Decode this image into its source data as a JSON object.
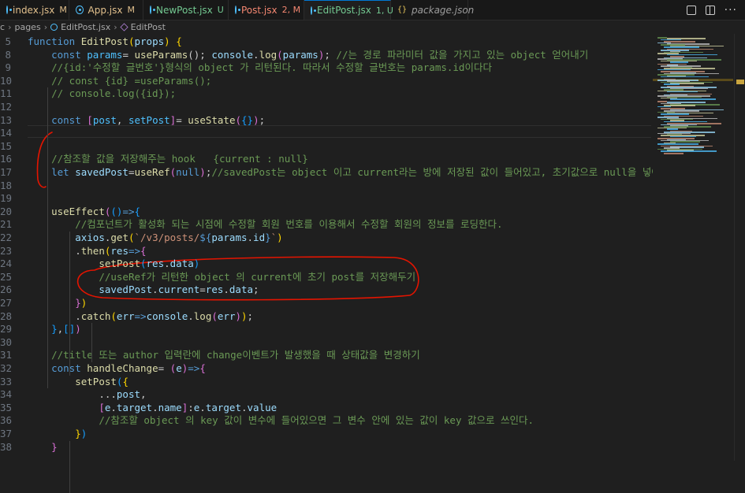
{
  "tabs": [
    {
      "name": "index.jsx",
      "badge": "M",
      "kind": "react",
      "state": "mod"
    },
    {
      "name": "App.jsx",
      "badge": "M",
      "kind": "react",
      "state": "mod"
    },
    {
      "name": "NewPost.jsx",
      "badge": "U",
      "kind": "react",
      "state": "new"
    },
    {
      "name": "Post.jsx",
      "badge": "2, M",
      "kind": "react",
      "state": "err"
    },
    {
      "name": "EditPost.jsx",
      "badge": "1, U",
      "kind": "react",
      "state": "active"
    },
    {
      "name": "package.json",
      "badge": "",
      "kind": "json",
      "state": "json"
    }
  ],
  "breadcrumb": {
    "prefix": "c",
    "folder": "pages",
    "file": "EditPost.jsx",
    "symbol": "EditPost"
  },
  "editor": {
    "lines": [
      {
        "n": "5",
        "t": [
          [
            "function",
            "k"
          ],
          [
            " ",
            "p"
          ],
          [
            "EditPost",
            "f"
          ],
          [
            "(",
            "b1"
          ],
          [
            "props",
            "v"
          ],
          [
            ")",
            "b1"
          ],
          [
            " {",
            "b1"
          ]
        ]
      },
      {
        "n": "8",
        "t": [
          [
            "    ",
            "p"
          ],
          [
            "const",
            "k"
          ],
          [
            " ",
            "p"
          ],
          [
            "params",
            "c"
          ],
          [
            "= ",
            "p"
          ],
          [
            "useParams",
            "f"
          ],
          [
            "();",
            "p"
          ],
          [
            " console",
            "v"
          ],
          [
            ".",
            "p"
          ],
          [
            "log",
            "f"
          ],
          [
            "(",
            "b2"
          ],
          [
            "params",
            "v"
          ],
          [
            ")",
            "b2"
          ],
          [
            "; ",
            "p"
          ],
          [
            "//는 경로 파라미터 값을 가지고 있는 object 얻어내기",
            "cm"
          ]
        ]
      },
      {
        "n": "9",
        "t": [
          [
            "    ",
            "p"
          ],
          [
            "//{id:'수정할 글번호'}형식의 object 가 리턴된다. 따라서 수정할 글번호는 params.id이다다",
            "cm"
          ]
        ]
      },
      {
        "n": "10",
        "t": [
          [
            "    ",
            "p"
          ],
          [
            "// const {id} =useParams();",
            "cm"
          ]
        ]
      },
      {
        "n": "11",
        "t": [
          [
            "    ",
            "p"
          ],
          [
            "// console.log({id});",
            "cm"
          ]
        ]
      },
      {
        "n": "12",
        "t": []
      },
      {
        "n": "13",
        "t": [
          [
            "    ",
            "p"
          ],
          [
            "const",
            "k"
          ],
          [
            " ",
            "p"
          ],
          [
            "[",
            "b2"
          ],
          [
            "post",
            "c"
          ],
          [
            ", ",
            "p"
          ],
          [
            "setPost",
            "c"
          ],
          [
            "]",
            "b2"
          ],
          [
            "= ",
            "p"
          ],
          [
            "useState",
            "f"
          ],
          [
            "(",
            "b2"
          ],
          [
            "{}",
            "b3"
          ],
          [
            ")",
            "b2"
          ],
          [
            ";",
            "p"
          ]
        ]
      },
      {
        "n": "14",
        "t": []
      },
      {
        "n": "15",
        "t": []
      },
      {
        "n": "16",
        "t": [
          [
            "    ",
            "p"
          ],
          [
            "//참조할 값을 저장해주는 hook   {current : null}",
            "cm"
          ]
        ]
      },
      {
        "n": "17",
        "t": [
          [
            "    ",
            "p"
          ],
          [
            "let",
            "k"
          ],
          [
            " ",
            "p"
          ],
          [
            "savedPost",
            "v"
          ],
          [
            "=",
            "p"
          ],
          [
            "useRef",
            "f"
          ],
          [
            "(",
            "b2"
          ],
          [
            "null",
            "k"
          ],
          [
            ")",
            "b2"
          ],
          [
            ";",
            "p"
          ],
          [
            "//savedPost는 object 이고 current라는 방에 저장된 값이 들어있고, 초기값으로 null을 넣어줬",
            "cm"
          ]
        ]
      },
      {
        "n": "18",
        "t": []
      },
      {
        "n": "19",
        "t": []
      },
      {
        "n": "20",
        "t": [
          [
            "    ",
            "p"
          ],
          [
            "useEffect",
            "f"
          ],
          [
            "(",
            "b2"
          ],
          [
            "()",
            "b3"
          ],
          [
            "=>",
            "k"
          ],
          [
            "{",
            "b3"
          ]
        ]
      },
      {
        "n": "21",
        "t": [
          [
            "        ",
            "p"
          ],
          [
            "//컴포넌트가 활성화 되는 시점에 수정할 회원 번호를 이용해서 수정할 회원의 정보를 로딩한다.",
            "cm"
          ]
        ]
      },
      {
        "n": "22",
        "t": [
          [
            "        ",
            "p"
          ],
          [
            "axios",
            "v"
          ],
          [
            ".",
            "p"
          ],
          [
            "get",
            "f"
          ],
          [
            "(",
            "b1"
          ],
          [
            "`/v3/posts/",
            "s"
          ],
          [
            "${",
            "k"
          ],
          [
            "params",
            "v"
          ],
          [
            ".",
            "p"
          ],
          [
            "id",
            "v"
          ],
          [
            "}",
            "k"
          ],
          [
            "`",
            "s"
          ],
          [
            ")",
            "b1"
          ]
        ]
      },
      {
        "n": "23",
        "t": [
          [
            "        ",
            "p"
          ],
          [
            ".",
            "p"
          ],
          [
            "then",
            "f"
          ],
          [
            "(",
            "b1"
          ],
          [
            "res",
            "v"
          ],
          [
            "=>",
            "k"
          ],
          [
            "{",
            "b2"
          ]
        ]
      },
      {
        "n": "24",
        "t": [
          [
            "            ",
            "p"
          ],
          [
            "setPost",
            "f"
          ],
          [
            "(",
            "b3"
          ],
          [
            "res",
            "v"
          ],
          [
            ".",
            "p"
          ],
          [
            "data",
            "v"
          ],
          [
            ")",
            "b3"
          ]
        ]
      },
      {
        "n": "25",
        "t": [
          [
            "            ",
            "p"
          ],
          [
            "//useRef가 리턴한 object 의 current에 초기 post를 저장해두기",
            "cm"
          ]
        ]
      },
      {
        "n": "26",
        "t": [
          [
            "            ",
            "p"
          ],
          [
            "savedPost",
            "v"
          ],
          [
            ".",
            "p"
          ],
          [
            "current",
            "v"
          ],
          [
            "=",
            "p"
          ],
          [
            "res",
            "v"
          ],
          [
            ".",
            "p"
          ],
          [
            "data",
            "v"
          ],
          [
            ";",
            "p"
          ]
        ]
      },
      {
        "n": "27",
        "t": [
          [
            "        ",
            "p"
          ],
          [
            "}",
            "b2"
          ],
          [
            ")",
            "b1"
          ]
        ]
      },
      {
        "n": "28",
        "t": [
          [
            "        ",
            "p"
          ],
          [
            ".",
            "p"
          ],
          [
            "catch",
            "f"
          ],
          [
            "(",
            "b1"
          ],
          [
            "err",
            "v"
          ],
          [
            "=>",
            "k"
          ],
          [
            "console",
            "v"
          ],
          [
            ".",
            "p"
          ],
          [
            "log",
            "f"
          ],
          [
            "(",
            "b2"
          ],
          [
            "err",
            "v"
          ],
          [
            ")",
            "b2"
          ],
          [
            ")",
            "b1"
          ],
          [
            ";",
            "p"
          ]
        ]
      },
      {
        "n": "29",
        "t": [
          [
            "    ",
            "p"
          ],
          [
            "}",
            "b3"
          ],
          [
            ",",
            "p"
          ],
          [
            "[]",
            "b3"
          ],
          [
            ")",
            "b2"
          ]
        ]
      },
      {
        "n": "30",
        "t": []
      },
      {
        "n": "31",
        "t": [
          [
            "    ",
            "p"
          ],
          [
            "//title 또는 author 입력란에 change이벤트가 발생했을 때 상태값을 변경하기",
            "cm"
          ]
        ]
      },
      {
        "n": "32",
        "t": [
          [
            "    ",
            "p"
          ],
          [
            "const",
            "k"
          ],
          [
            " ",
            "p"
          ],
          [
            "handleChange",
            "f"
          ],
          [
            "= ",
            "p"
          ],
          [
            "(",
            "b2"
          ],
          [
            "e",
            "v"
          ],
          [
            ")",
            "b2"
          ],
          [
            "=>",
            "k"
          ],
          [
            "{",
            "b2"
          ]
        ]
      },
      {
        "n": "33",
        "t": [
          [
            "        ",
            "p"
          ],
          [
            "setPost",
            "f"
          ],
          [
            "(",
            "b3"
          ],
          [
            "{",
            "b1"
          ]
        ]
      },
      {
        "n": "34",
        "t": [
          [
            "            ",
            "p"
          ],
          [
            "...",
            "p"
          ],
          [
            "post",
            "v"
          ],
          [
            ",",
            "p"
          ]
        ]
      },
      {
        "n": "35",
        "t": [
          [
            "            ",
            "p"
          ],
          [
            "[",
            "b2"
          ],
          [
            "e",
            "v"
          ],
          [
            ".",
            "p"
          ],
          [
            "target",
            "v"
          ],
          [
            ".",
            "p"
          ],
          [
            "name",
            "v"
          ],
          [
            "]",
            "b2"
          ],
          [
            ":",
            "p"
          ],
          [
            "e",
            "v"
          ],
          [
            ".",
            "p"
          ],
          [
            "target",
            "v"
          ],
          [
            ".",
            "p"
          ],
          [
            "value",
            "v"
          ]
        ]
      },
      {
        "n": "36",
        "t": [
          [
            "            ",
            "p"
          ],
          [
            "//참조할 object 의 key 값이 변수에 들어있으면 그 변수 안에 있는 값이 key 값으로 쓰인다.",
            "cm"
          ]
        ]
      },
      {
        "n": "37",
        "t": [
          [
            "        ",
            "p"
          ],
          [
            "}",
            "b1"
          ],
          [
            ")",
            "b3"
          ]
        ]
      },
      {
        "n": "38",
        "t": [
          [
            "    ",
            "p"
          ],
          [
            "}",
            "b2"
          ]
        ]
      }
    ]
  },
  "annotation_color": "#e51400",
  "theme": {
    "background": "#1f1f1f",
    "accent": "#0078d4",
    "comment": "#6a9955"
  }
}
